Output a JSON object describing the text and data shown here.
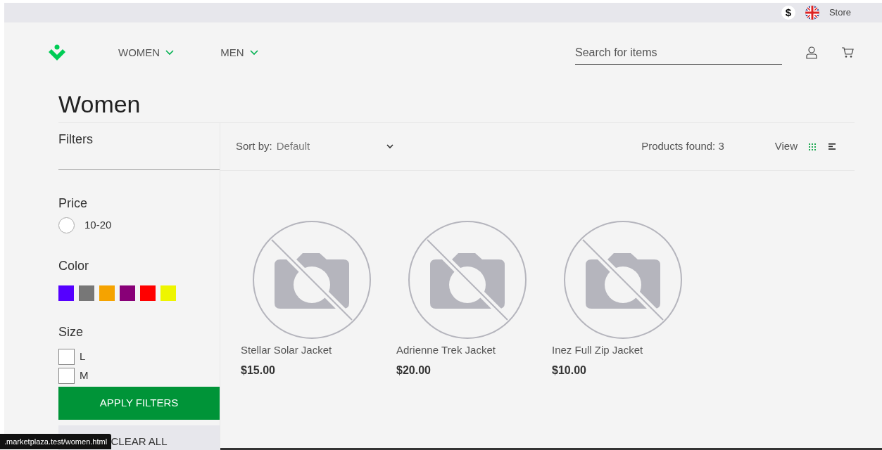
{
  "top_bar": {
    "currency": "$",
    "store_label": "Store"
  },
  "nav": {
    "items": [
      {
        "label": "WOMEN"
      },
      {
        "label": "MEN"
      }
    ],
    "search": {
      "placeholder": "Search for items"
    }
  },
  "page_title": "Women",
  "filters": {
    "title": "Filters",
    "groups": [
      {
        "kind": "radio",
        "title": "Price",
        "options": [
          {
            "label": "10-20",
            "checked": false
          }
        ]
      },
      {
        "kind": "swatch",
        "title": "Color",
        "swatches": [
          {
            "color": "#5500ff"
          },
          {
            "color": "#777777"
          },
          {
            "color": "#f5a300"
          },
          {
            "color": "#880077"
          },
          {
            "color": "#ff0000"
          },
          {
            "color": "#eef500"
          }
        ]
      },
      {
        "kind": "checkbox",
        "title": "Size",
        "options": [
          {
            "label": "L",
            "checked": false
          },
          {
            "label": "M",
            "checked": false
          }
        ]
      }
    ],
    "apply_button": "APPLY FILTERS",
    "clear_button": "CLEAR ALL"
  },
  "toolbar": {
    "sort_label": "Sort by:",
    "sort_value": "Default",
    "products_found": "Products found: 3",
    "view_label": "View",
    "views": [
      {
        "kind": "grid",
        "selected": true
      },
      {
        "kind": "list",
        "selected": false
      }
    ]
  },
  "products": [
    {
      "name": "Stellar Solar Jacket",
      "price": "$15.00"
    },
    {
      "name": "Adrienne Trek Jacket",
      "price": "$20.00"
    },
    {
      "name": "Inez Full Zip Jacket",
      "price": "$10.00"
    }
  ],
  "status_url": ".marketplaza.test/women.html"
}
